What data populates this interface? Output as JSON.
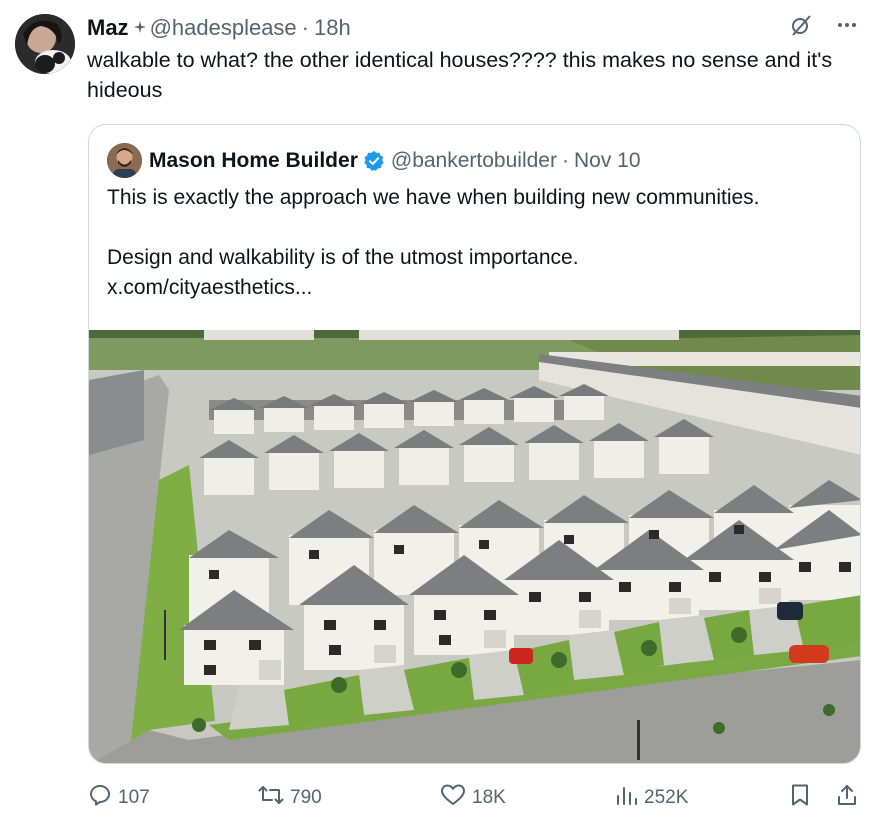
{
  "tweet": {
    "author_name": "Maz",
    "author_handle": "@hadesplease",
    "time": "18h",
    "text": "walkable to what? the other identical houses???? this makes no sense and it's hideous"
  },
  "quote": {
    "author_name": "Mason Home Builder",
    "author_handle": "@bankertobuilder",
    "date": "Nov 10",
    "line1": "This is exactly the approach we have when building new communities.",
    "line2": "Design and walkability is of the utmost importance.",
    "line3": "x.com/cityaesthetics..."
  },
  "actions": {
    "replies": "107",
    "reposts": "790",
    "likes": "18K",
    "views": "252K"
  },
  "colors": {
    "muted": "#536471",
    "verified": "#1d9bf0",
    "border": "#cfd9de",
    "text": "#0f1419"
  },
  "icons": [
    "sparkle-icon",
    "grok-icon",
    "more-icon",
    "verified-badge-icon",
    "reply-icon",
    "repost-icon",
    "like-icon",
    "views-icon",
    "bookmark-icon",
    "share-icon"
  ]
}
